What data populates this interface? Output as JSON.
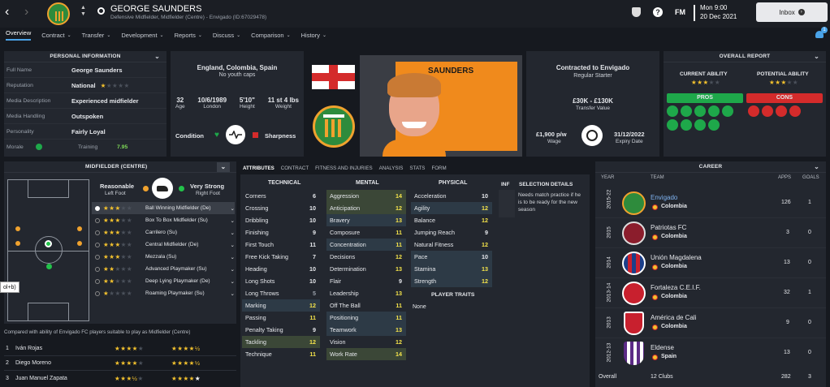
{
  "header": {
    "name": "GEORGE SAUNDERS",
    "subtitle": "Defensive Midfielder, Midfielder (Centre) - Envigado (ID:67029478)",
    "time": "Mon 9:00",
    "date": "20 Dec 2021",
    "inbox": "Inbox",
    "fm": "FM",
    "badge_count": "1"
  },
  "nav": [
    "Overview",
    "Contract",
    "Transfer",
    "Development",
    "Reports",
    "Discuss",
    "Comparison",
    "History"
  ],
  "personal": {
    "title": "PERSONAL INFORMATION",
    "rows": [
      {
        "k": "Full Name",
        "v": "George Saunders"
      },
      {
        "k": "Reputation",
        "v": "National"
      },
      {
        "k": "Media Description",
        "v": "Experienced midfielder"
      },
      {
        "k": "Media Handling",
        "v": "Outspoken"
      },
      {
        "k": "Personality",
        "v": "Fairly Loyal"
      }
    ],
    "morale": "Morale",
    "training": "Training",
    "training_value": "7.95"
  },
  "bio": {
    "nations": "England, Colombia, Spain",
    "caps": "No youth caps",
    "age": "32",
    "age_l": "Age",
    "dob": "10/6/1989",
    "dob_l": "London",
    "height": "5'10\"",
    "height_l": "Height",
    "weight": "11 st 4 lbs",
    "weight_l": "Weight",
    "condition": "Condition",
    "sharpness": "Sharpness"
  },
  "portrait": {
    "name": "SAUNDERS"
  },
  "contract": {
    "title": "Contracted to Envigado",
    "status": "Regular Starter",
    "value": "£30K - £130K",
    "value_l": "Transfer Value",
    "wage": "£1,900 p/w",
    "wage_l": "Wage",
    "expiry": "31/12/2022",
    "expiry_l": "Expiry Date"
  },
  "report": {
    "title": "OVERALL REPORT",
    "ca": "CURRENT ABILITY",
    "pa": "POTENTIAL ABILITY",
    "pros": "PROS",
    "cons": "CONS"
  },
  "position": {
    "title": "MIDFIELDER (CENTRE)",
    "left_rating": "Reasonable",
    "left_foot": "Left Foot",
    "right_rating": "Very Strong",
    "right_foot": "Right Foot",
    "tooltip": "ol+b)"
  },
  "roles": [
    "Ball Winning Midfielder (De)",
    "Box To Box Midfielder (Su)",
    "Carrilero (Su)",
    "Central Midfielder (De)",
    "Mezzala (Su)",
    "Advanced Playmaker (Su)",
    "Deep Lying Playmaker (De)",
    "Roaming Playmaker (Su)"
  ],
  "compare": {
    "caption": "Compared with ability of Envigado FC players suitable to play as Midfielder (Centre)",
    "players": [
      {
        "n": "1",
        "name": "Iván Rojas"
      },
      {
        "n": "2",
        "name": "Diego Moreno"
      },
      {
        "n": "3",
        "name": "Juan Manuel Zapata"
      }
    ]
  },
  "attr_tabs": [
    "ATTRIBUTES",
    "CONTRACT",
    "FITNESS AND INJURIES",
    "ANALYSIS",
    "STATS",
    "FORM"
  ],
  "technical_title": "TECHNICAL",
  "mental_title": "MENTAL",
  "physical_title": "PHYSICAL",
  "technical": [
    {
      "k": "Corners",
      "v": "6"
    },
    {
      "k": "Crossing",
      "v": "10"
    },
    {
      "k": "Dribbling",
      "v": "10"
    },
    {
      "k": "Finishing",
      "v": "9"
    },
    {
      "k": "First Touch",
      "v": "11"
    },
    {
      "k": "Free Kick Taking",
      "v": "7"
    },
    {
      "k": "Heading",
      "v": "10"
    },
    {
      "k": "Long Shots",
      "v": "10"
    },
    {
      "k": "Long Throws",
      "v": "5"
    },
    {
      "k": "Marking",
      "v": "12"
    },
    {
      "k": "Passing",
      "v": "11"
    },
    {
      "k": "Penalty Taking",
      "v": "9"
    },
    {
      "k": "Tackling",
      "v": "12"
    },
    {
      "k": "Technique",
      "v": "11"
    }
  ],
  "mental": [
    {
      "k": "Aggression",
      "v": "14"
    },
    {
      "k": "Anticipation",
      "v": "12"
    },
    {
      "k": "Bravery",
      "v": "13"
    },
    {
      "k": "Composure",
      "v": "11"
    },
    {
      "k": "Concentration",
      "v": "11"
    },
    {
      "k": "Decisions",
      "v": "12"
    },
    {
      "k": "Determination",
      "v": "13"
    },
    {
      "k": "Flair",
      "v": "9"
    },
    {
      "k": "Leadership",
      "v": "13"
    },
    {
      "k": "Off The Ball",
      "v": "11"
    },
    {
      "k": "Positioning",
      "v": "11"
    },
    {
      "k": "Teamwork",
      "v": "13"
    },
    {
      "k": "Vision",
      "v": "12"
    },
    {
      "k": "Work Rate",
      "v": "14"
    }
  ],
  "physical": [
    {
      "k": "Acceleration",
      "v": "10"
    },
    {
      "k": "Agility",
      "v": "12"
    },
    {
      "k": "Balance",
      "v": "12"
    },
    {
      "k": "Jumping Reach",
      "v": "9"
    },
    {
      "k": "Natural Fitness",
      "v": "12"
    },
    {
      "k": "Pace",
      "v": "10"
    },
    {
      "k": "Stamina",
      "v": "13"
    },
    {
      "k": "Strength",
      "v": "12"
    }
  ],
  "traits": {
    "title": "PLAYER TRAITS",
    "value": "None"
  },
  "inf": "INF",
  "selection": {
    "title": "SELECTION DETAILS",
    "text": "Needs match practice if he is to be ready for the new season"
  },
  "career": {
    "title": "CAREER",
    "h_year": "YEAR",
    "h_team": "TEAM",
    "h_apps": "APPS",
    "h_goals": "GOALS",
    "rows": [
      {
        "year": "2015-22",
        "team": "Envigado",
        "country": "Colombia",
        "apps": "126",
        "goals": "1"
      },
      {
        "year": "2015",
        "team": "Patriotas FC",
        "country": "Colombia",
        "apps": "3",
        "goals": "0"
      },
      {
        "year": "2014",
        "team": "Unión Magdalena",
        "country": "Colombia",
        "apps": "13",
        "goals": "0"
      },
      {
        "year": "2013-14",
        "team": "Fortaleza C.E.I.F.",
        "country": "Colombia",
        "apps": "32",
        "goals": "1"
      },
      {
        "year": "2013",
        "team": "América de Cali",
        "country": "Colombia",
        "apps": "9",
        "goals": "0"
      },
      {
        "year": "2012-13",
        "team": "Eldense",
        "country": "Spain",
        "apps": "13",
        "goals": "0"
      }
    ],
    "overall": "Overall",
    "overall_clubs": "12 Clubs",
    "overall_apps": "282",
    "overall_goals": "3"
  },
  "colors": {
    "accent": "#4aa3e8",
    "pros": "#1ea84a",
    "cons": "#d42b2b",
    "highlight": "#f4e34a",
    "portrait_bg": "#f08a1c"
  }
}
